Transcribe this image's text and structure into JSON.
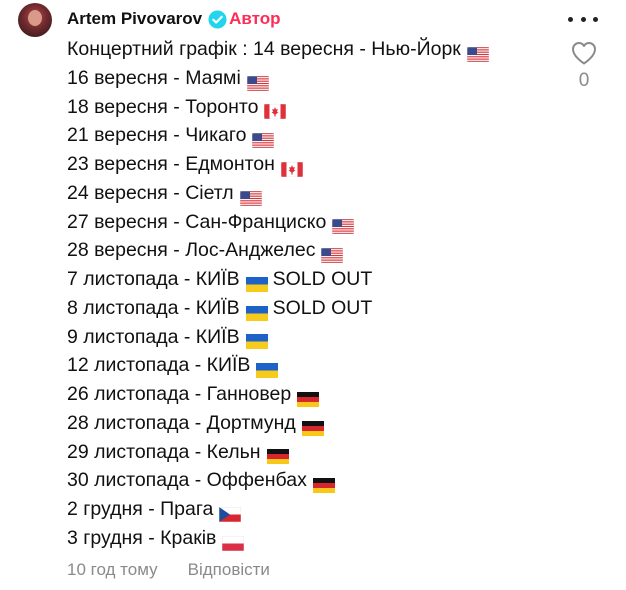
{
  "comment": {
    "author": {
      "name": "Artem Pivovarov",
      "badge": "Автор",
      "badge_color": "#fe2c55",
      "verified_icon": "verified-check-icon",
      "verified_color": "#20d5ec"
    },
    "menu_icon": "more-options-icon",
    "likes": {
      "icon": "heart-outline-icon",
      "count": "0"
    },
    "lines": [
      {
        "text": "Концертний графік : 14 вересня - Нью-Йорк",
        "flag": "us",
        "suffix": ""
      },
      {
        "text": "16 вересня - Маямі",
        "flag": "us",
        "suffix": ""
      },
      {
        "text": "18 вересня - Торонто",
        "flag": "ca",
        "suffix": ""
      },
      {
        "text": "21 вересня - Чикаго",
        "flag": "us",
        "suffix": ""
      },
      {
        "text": "23 вересня - Едмонтон",
        "flag": "ca",
        "suffix": ""
      },
      {
        "text": "24 вересня - Сіетл",
        "flag": "us",
        "suffix": ""
      },
      {
        "text": "27 вересня - Сан-Франциско",
        "flag": "us",
        "suffix": ""
      },
      {
        "text": "28 вересня - Лос-Анджелес",
        "flag": "us",
        "suffix": ""
      },
      {
        "text": "7 листопада - КИЇВ",
        "flag": "ua",
        "suffix": "SOLD OUT"
      },
      {
        "text": "8 листопада - КИЇВ",
        "flag": "ua",
        "suffix": "SOLD OUT"
      },
      {
        "text": "9 листопада - КИЇВ",
        "flag": "ua",
        "suffix": ""
      },
      {
        "text": "12 листопада - КИЇВ",
        "flag": "ua",
        "suffix": ""
      },
      {
        "text": "26 листопада - Ганновер",
        "flag": "de",
        "suffix": ""
      },
      {
        "text": "28 листопада - Дортмунд",
        "flag": "de",
        "suffix": ""
      },
      {
        "text": "29 листопада - Кельн",
        "flag": "de",
        "suffix": ""
      },
      {
        "text": "30 листопада - Оффенбах",
        "flag": "de",
        "suffix": ""
      },
      {
        "text": "2 грудня - Прага",
        "flag": "cz",
        "suffix": ""
      },
      {
        "text": "3 грудня - Краків",
        "flag": "pl",
        "suffix": ""
      }
    ],
    "footer": {
      "time_ago": "10 год тому",
      "reply_label": "Відповісти"
    }
  }
}
